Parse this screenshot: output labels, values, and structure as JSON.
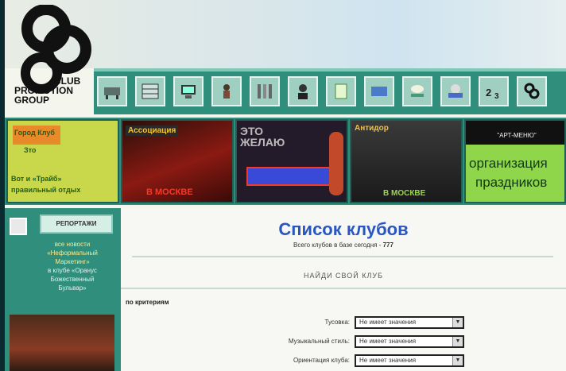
{
  "logo": {
    "line1": "CLUB",
    "line2": "PROMOTION",
    "line3": "GROUP"
  },
  "nav_buttons": [
    {
      "icon": "desk-icon"
    },
    {
      "icon": "grid-icon"
    },
    {
      "icon": "computer-icon"
    },
    {
      "icon": "musician-icon"
    },
    {
      "icon": "stripes-icon"
    },
    {
      "icon": "dj-icon"
    },
    {
      "icon": "document-icon"
    },
    {
      "icon": "monitor-icon"
    },
    {
      "icon": "lamp-icon"
    },
    {
      "icon": "car-icon"
    },
    {
      "icon": "numbers-icon",
      "text": "2 3"
    },
    {
      "icon": "club-logo-icon"
    }
  ],
  "banners": [
    {
      "name": "banner-1",
      "bg": "#c8d84a",
      "lines": [
        "Город Клуб",
        "Зто",
        "Вот и «Трайб»",
        "правильный отдых"
      ]
    },
    {
      "name": "banner-2",
      "bg": "#7a1a12",
      "lines": [
        "Ассоциация",
        "В МОСКВЕ"
      ]
    },
    {
      "name": "banner-3",
      "bg": "#2b2035",
      "lines": [
        "ЭТО",
        "ЖЕЛАЮ"
      ]
    },
    {
      "name": "banner-4",
      "bg": "#2a2a2a",
      "lines": [
        "Антидор",
        "В МОСКВЕ"
      ]
    },
    {
      "name": "banner-5",
      "bg": "#8fd64a",
      "lines": [
        "\"АРТ-МЕНЮ\"",
        "организация",
        "праздников"
      ]
    }
  ],
  "sidebar": {
    "header": "РЕПОРТАЖИ",
    "news_lines": [
      "все новости",
      "«Неформальный",
      "Маркетинг»",
      "в клубе «Оранус",
      "Божественный",
      "Бульвар»"
    ]
  },
  "main": {
    "title": "Список клубов",
    "subtitle_prefix": "Всего клубов в базе сегодня -",
    "subtitle_count": "777",
    "find_link": "НАЙДИ СВОЙ КЛУБ",
    "criteria_label": "по критериям",
    "filters": [
      {
        "label": "Тусовка:",
        "value": "Не имеет значения"
      },
      {
        "label": "Музыкальный стиль:",
        "value": "Не имеет значения"
      },
      {
        "label": "Ориентация клуба:",
        "value": "Не имеет значения"
      }
    ]
  },
  "colors": {
    "accent_teal": "#2f8f7c",
    "title_blue": "#2a56c0"
  }
}
